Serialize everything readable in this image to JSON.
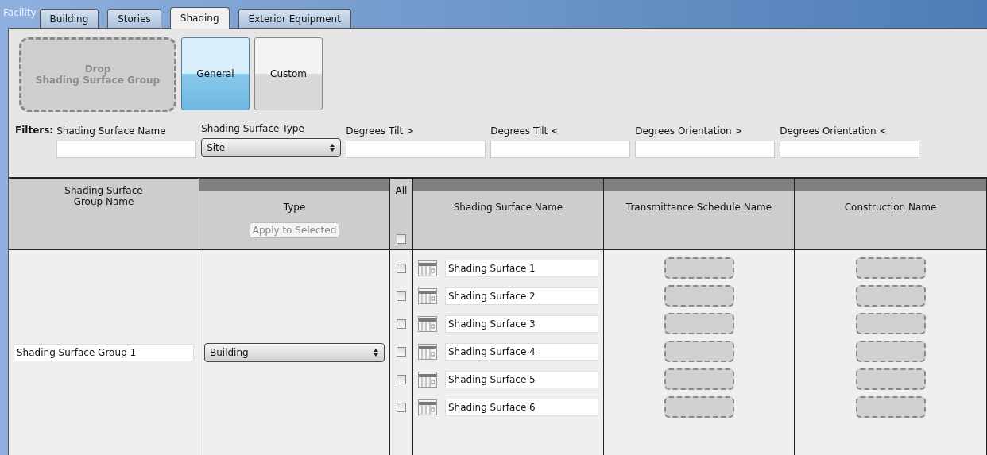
{
  "section_label": "Facility",
  "tabs": [
    {
      "label": "Building",
      "selected": false
    },
    {
      "label": "Stories",
      "selected": false
    },
    {
      "label": "Shading",
      "selected": true
    },
    {
      "label": "Exterior Equipment",
      "selected": false
    }
  ],
  "drop_zone": {
    "label": "Drop\nShading Surface Group"
  },
  "mode_buttons": [
    {
      "label": "General",
      "selected": true
    },
    {
      "label": "Custom",
      "selected": false
    }
  ],
  "filters": {
    "label": "Filters:",
    "fields": [
      {
        "kind": "text",
        "label": "Shading Surface Name"
      },
      {
        "kind": "select",
        "label": "Shading Surface Type",
        "value": "Site"
      },
      {
        "kind": "text",
        "label": "Degrees Tilt >"
      },
      {
        "kind": "text",
        "label": "Degrees Tilt <"
      },
      {
        "kind": "text",
        "label": "Degrees Orientation >"
      },
      {
        "kind": "text",
        "label": "Degrees Orientation <"
      }
    ]
  },
  "table": {
    "columns": [
      {
        "kind": "plain",
        "label": "Shading Surface\nGroup Name"
      },
      {
        "kind": "banded",
        "label": "Type",
        "button": "Apply to Selected"
      },
      {
        "kind": "check",
        "label": "All",
        "checked": false
      },
      {
        "kind": "banded",
        "label": "Shading Surface Name"
      },
      {
        "kind": "banded",
        "label": "Transmittance Schedule Name"
      },
      {
        "kind": "banded",
        "label": "Construction Name"
      }
    ],
    "rows": [
      {
        "group_name": "Shading Surface Group 1",
        "type": "Building",
        "surfaces": [
          {
            "name": "Shading Surface 1",
            "checked": false
          },
          {
            "name": "Shading Surface 2",
            "checked": false
          },
          {
            "name": "Shading Surface 3",
            "checked": false
          },
          {
            "name": "Shading Surface 4",
            "checked": false
          },
          {
            "name": "Shading Surface 5",
            "checked": false
          },
          {
            "name": "Shading Surface 6",
            "checked": false
          }
        ]
      }
    ]
  }
}
